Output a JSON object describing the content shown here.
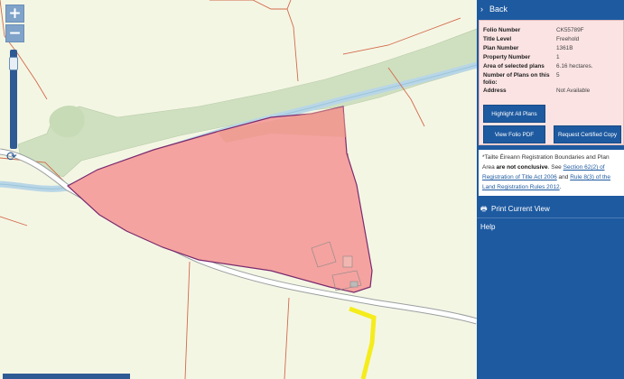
{
  "zoom": {
    "in_label": "+",
    "out_label": "−",
    "level": 0.92
  },
  "icons": {
    "refresh": "refresh-icon",
    "printer": "printer-icon",
    "back": "chevron-right-icon"
  },
  "panel": {
    "back_label": "Back",
    "folio": {
      "rows": [
        {
          "label": "Folio Number",
          "value": "CK55789F"
        },
        {
          "label": "Title Level",
          "value": "Freehold"
        },
        {
          "label": "Plan Number",
          "value": "1361B"
        },
        {
          "label": "Property Number",
          "value": "1"
        },
        {
          "label": "Area of selected plans",
          "value": "6.16 hectares."
        },
        {
          "label": "Number of Plans on this folio:",
          "value": "5"
        },
        {
          "label": "Address",
          "value": "Not Available"
        }
      ]
    },
    "buttons": {
      "highlight": "Highlight All Plans",
      "view_pdf": "View Folio PDF",
      "request": "Request Certified Copy"
    },
    "notice": {
      "part1": "*Tailte Éireann Registration Boundaries and Plan Area ",
      "bold": "are not conclusive",
      "part2": ". See ",
      "link1": "Section 62(2) of Registration of Title Act 2006",
      "part3": " and ",
      "link2": "Rule 8(3) of the Land Registration Rules 2012",
      "part4": "."
    },
    "print_label": "Print Current View",
    "help_label": "Help"
  },
  "colors": {
    "panel_bg": "#1e5aa0",
    "folio_bg": "#fbe3e3",
    "parcel_fill": "#f4a3a0",
    "parcel_stroke": "#7a2a6e",
    "road_highlight": "#f5ec1c",
    "map_bg": "#f4f6e4",
    "woodland": "#cfe0c0",
    "river": "#b8d6e6"
  }
}
